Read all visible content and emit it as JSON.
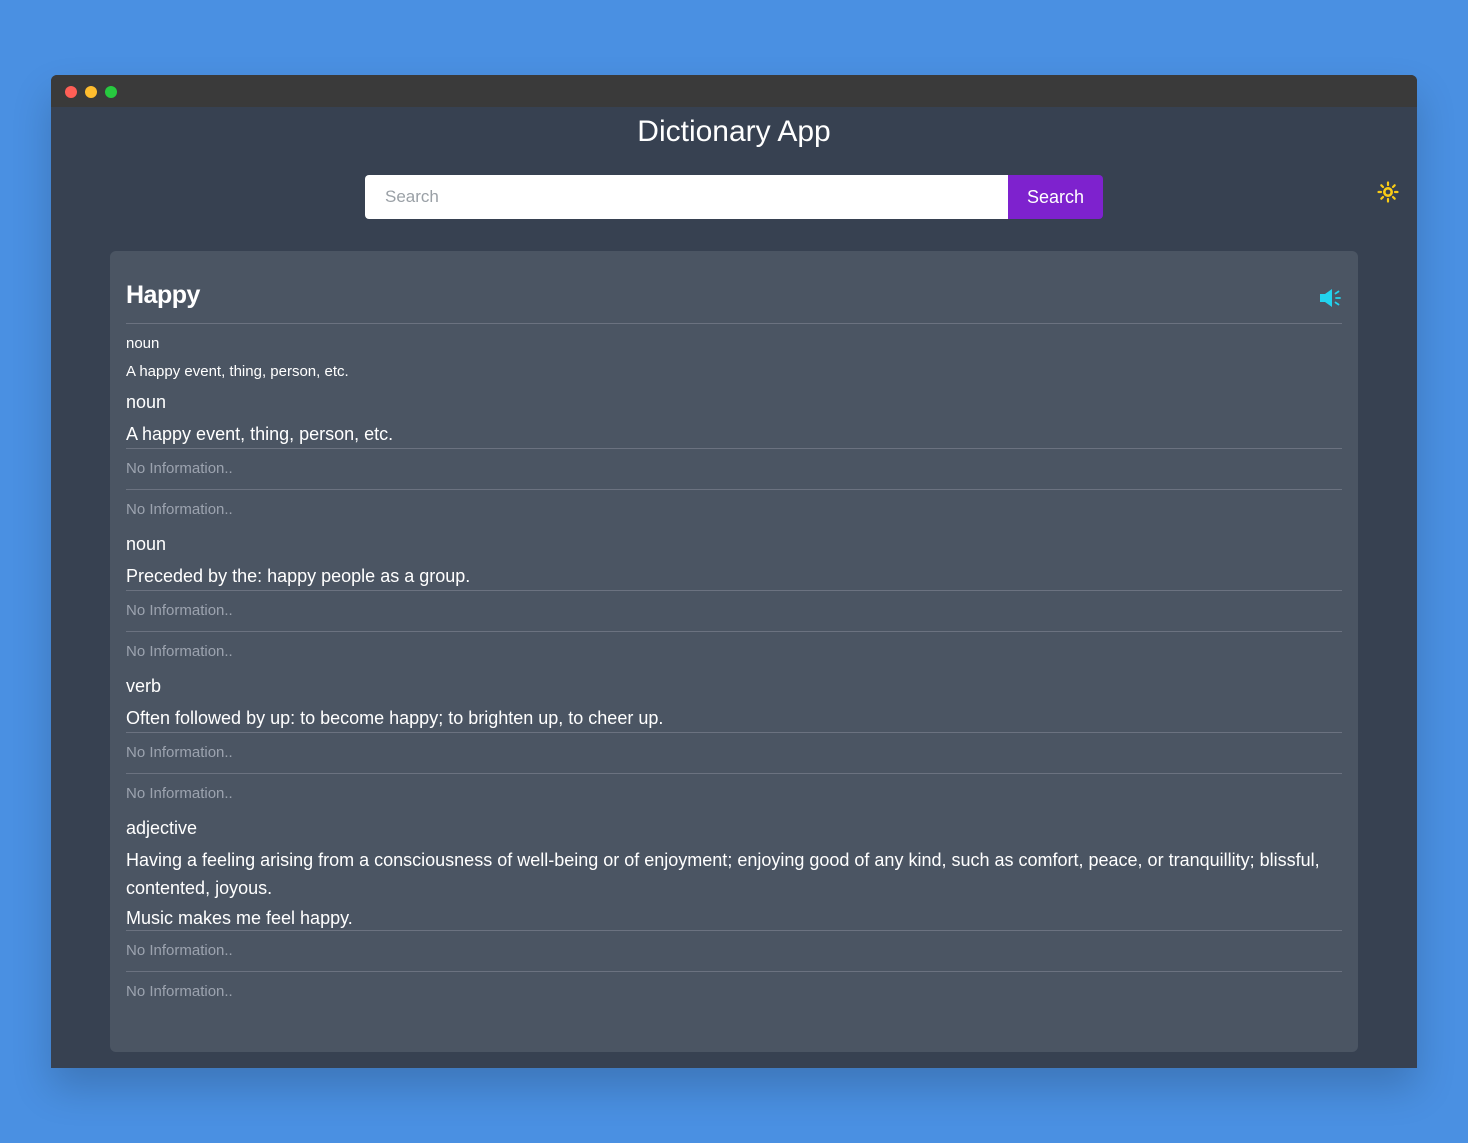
{
  "app": {
    "title": "Dictionary App"
  },
  "search": {
    "placeholder": "Search",
    "value": "",
    "button_label": "Search"
  },
  "theme": {
    "icon": "sun-icon",
    "color": "#facc15"
  },
  "colors": {
    "page_bg": "#4a90e2",
    "window_bg": "#374151",
    "card_bg": "#4b5563",
    "accent": "#7e22ce",
    "speaker": "#22d3ee"
  },
  "entry": {
    "word": "Happy",
    "speaker_icon": "speaker-icon",
    "summary": {
      "part_of_speech": "noun",
      "definition": "A happy event, thing, person, etc."
    },
    "meanings": [
      {
        "part_of_speech": "noun",
        "definition": "A happy event, thing, person, etc.",
        "example": "",
        "synonyms": "No Information..",
        "antonyms": "No Information.."
      },
      {
        "part_of_speech": "noun",
        "definition": "Preceded by the: happy people as a group.",
        "example": "",
        "synonyms": "No Information..",
        "antonyms": "No Information.."
      },
      {
        "part_of_speech": "verb",
        "definition": "Often followed by up: to become happy; to brighten up, to cheer up.",
        "example": "",
        "synonyms": "No Information..",
        "antonyms": "No Information.."
      },
      {
        "part_of_speech": "adjective",
        "definition": "Having a feeling arising from a consciousness of well-being or of enjoyment; enjoying good of any kind, such as comfort, peace, or tranquillity; blissful, contented, joyous.",
        "example": "Music makes me feel happy.",
        "synonyms": "No Information..",
        "antonyms": "No Information.."
      }
    ]
  }
}
